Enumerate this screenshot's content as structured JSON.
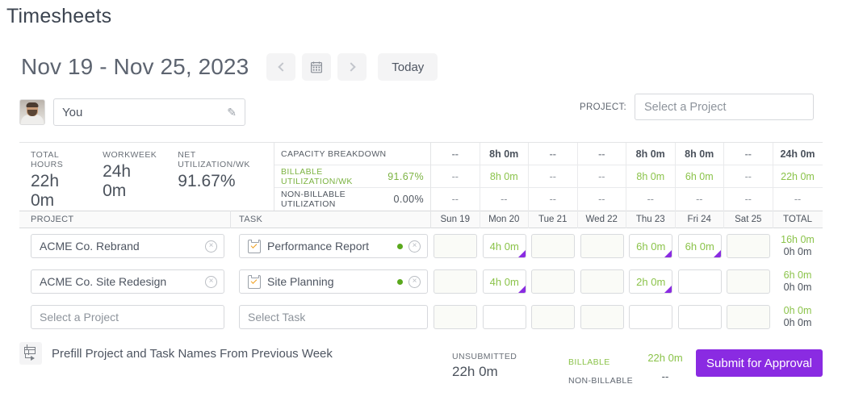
{
  "page_title": "Timesheets",
  "week": {
    "range_label": "Nov 19 - Nov 25, 2023",
    "prev_label": "‹",
    "calendar_icon": "calendar-icon",
    "next_label": "›",
    "today_label": "Today"
  },
  "user": {
    "name_value": "You",
    "edit_icon": "pencil-icon"
  },
  "project_selector": {
    "label": "PROJECT:",
    "placeholder": "Select a Project"
  },
  "kpis": [
    {
      "label": "TOTAL HOURS",
      "value": "22h 0m"
    },
    {
      "label": "WORKWEEK",
      "value": "24h 0m"
    },
    {
      "label": "NET UTILIZATION/WK",
      "value": "91.67%"
    }
  ],
  "capacity": {
    "title": "CAPACITY BREAKDOWN",
    "billable_label": "BILLABLE UTILIZATION/WK",
    "billable_value": "91.67%",
    "nonbillable_label": "NON-BILLABLE UTILIZATION",
    "nonbillable_value": "0.00%",
    "capacity_row": [
      "--",
      "8h 0m",
      "--",
      "--",
      "8h 0m",
      "8h 0m",
      "--",
      "24h 0m"
    ],
    "billable_row": [
      "--",
      "8h 0m",
      "--",
      "--",
      "8h 0m",
      "6h 0m",
      "--",
      "22h 0m"
    ],
    "nonbillable_row": [
      "--",
      "--",
      "--",
      "--",
      "--",
      "--",
      "--",
      "--"
    ]
  },
  "table": {
    "project_header": "PROJECT",
    "task_header": "TASK",
    "day_headers": [
      "Sun 19",
      "Mon 20",
      "Tue 21",
      "Wed 22",
      "Thu 23",
      "Fri 24",
      "Sat 25",
      "TOTAL"
    ],
    "rows": [
      {
        "project": "ACME Co. Rebrand",
        "task": "Performance Report",
        "task_icon": "clipboard-check-icon",
        "status_dot": "green",
        "hours": [
          "",
          "4h 0m",
          "",
          "",
          "6h 0m",
          "6h 0m",
          ""
        ],
        "tinted": [
          true,
          false,
          true,
          true,
          false,
          false,
          true
        ],
        "flagged": [
          false,
          true,
          false,
          false,
          true,
          true,
          false
        ],
        "total_billable": "16h 0m",
        "total_nonbillable": "0h 0m"
      },
      {
        "project": "ACME Co. Site Redesign",
        "task": "Site Planning",
        "task_icon": "clipboard-check-icon",
        "status_dot": "green",
        "hours": [
          "",
          "4h 0m",
          "",
          "",
          "2h 0m",
          "",
          ""
        ],
        "tinted": [
          true,
          false,
          true,
          true,
          false,
          false,
          true
        ],
        "flagged": [
          false,
          true,
          false,
          false,
          true,
          false,
          false
        ],
        "total_billable": "6h 0m",
        "total_nonbillable": "0h 0m"
      },
      {
        "project": "Select a Project",
        "task": "Select Task",
        "task_icon": "",
        "status_dot": "",
        "placeholder_row": true,
        "hours": [
          "",
          "",
          "",
          "",
          "",
          "",
          ""
        ],
        "tinted": [
          true,
          false,
          true,
          true,
          false,
          false,
          true
        ],
        "flagged": [
          false,
          false,
          false,
          false,
          false,
          false,
          false
        ],
        "total_billable": "0h 0m",
        "total_nonbillable": "0h 0m"
      }
    ]
  },
  "footer": {
    "prefill_icon": "table-arrow-icon",
    "prefill_label": "Prefill Project and Task Names From Previous Week",
    "unsubmitted_label": "UNSUBMITTED",
    "unsubmitted_value": "22h 0m",
    "billable_label": "BILLABLE",
    "nonbillable_label": "NON-BILLABLE",
    "billable_value": "22h 0m",
    "nonbillable_value": "--",
    "submit_label": "Submit for Approval"
  },
  "colors": {
    "accent_purple": "#8a2be2",
    "billable_green": "#8bc34a",
    "dot_green": "#5aa81d",
    "text": "#4b525c"
  }
}
